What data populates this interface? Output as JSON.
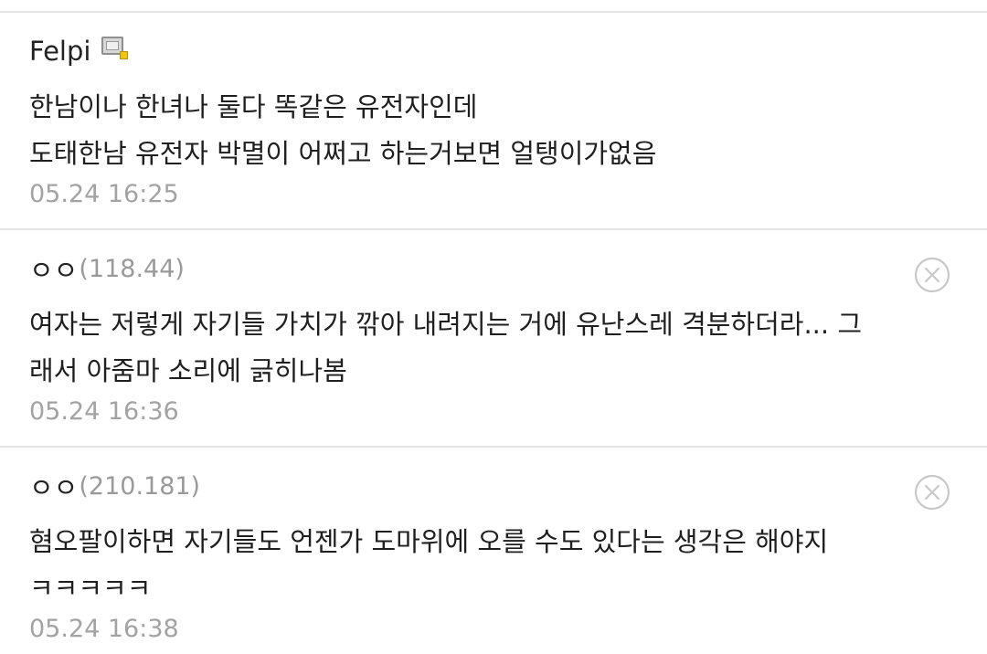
{
  "comments": [
    {
      "nickname": "Felpi",
      "member_icon": "fixed-member-icon",
      "ip": "",
      "lines": [
        "한남이나 한녀나 둘다 똑같은 유전자인데",
        "도태한남 유전자 박멸이 어쩌고 하는거보면 얼탱이가없음"
      ],
      "timestamp": "05.24 16:25"
    },
    {
      "nickname": "ㅇㅇ",
      "ip": "(118.44)",
      "lines": [
        "여자는 저렇게 자기들 가치가 깎아 내려지는 거에 유난스레 격분하더라... 그",
        "래서 아줌마 소리에 긁히나봄"
      ],
      "timestamp": "05.24 16:36",
      "delete_icon": "close-circle-icon"
    },
    {
      "nickname": "ㅇㅇ",
      "ip": "(210.181)",
      "lines": [
        "혐오팔이하면 자기들도 언젠가 도마위에 오를 수도 있다는 생각은 해야지",
        "ㅋㅋㅋㅋㅋ"
      ],
      "timestamp": "05.24 16:38",
      "delete_icon": "close-circle-icon"
    }
  ],
  "colors": {
    "text": "#1f1f1f",
    "meta_gray": "#a3a3a3",
    "divider": "#e3e3e3",
    "delete_icon": "#c8c8c8"
  }
}
